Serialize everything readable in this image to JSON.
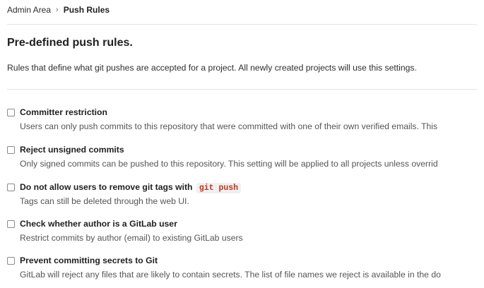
{
  "breadcrumb": {
    "parent": "Admin Area",
    "separator": "›",
    "current": "Push Rules"
  },
  "page": {
    "title": "Pre-defined push rules.",
    "description": "Rules that define what git pushes are accepted for a project. All newly created projects will use this settings."
  },
  "rules": [
    {
      "label": "Committer restriction",
      "checked": false,
      "help": "Users can only push commits to this repository that were committed with one of their own verified emails. This"
    },
    {
      "label": "Reject unsigned commits",
      "checked": false,
      "help": "Only signed commits can be pushed to this repository. This setting will be applied to all projects unless overrid"
    },
    {
      "label": "Do not allow users to remove git tags with",
      "code": "git push",
      "checked": false,
      "help": "Tags can still be deleted through the web UI."
    },
    {
      "label": "Check whether author is a GitLab user",
      "checked": false,
      "help": "Restrict commits by author (email) to existing GitLab users"
    },
    {
      "label": "Prevent committing secrets to Git",
      "checked": false,
      "help": "GitLab will reject any files that are likely to contain secrets. The list of file names we reject is available in the do"
    }
  ]
}
